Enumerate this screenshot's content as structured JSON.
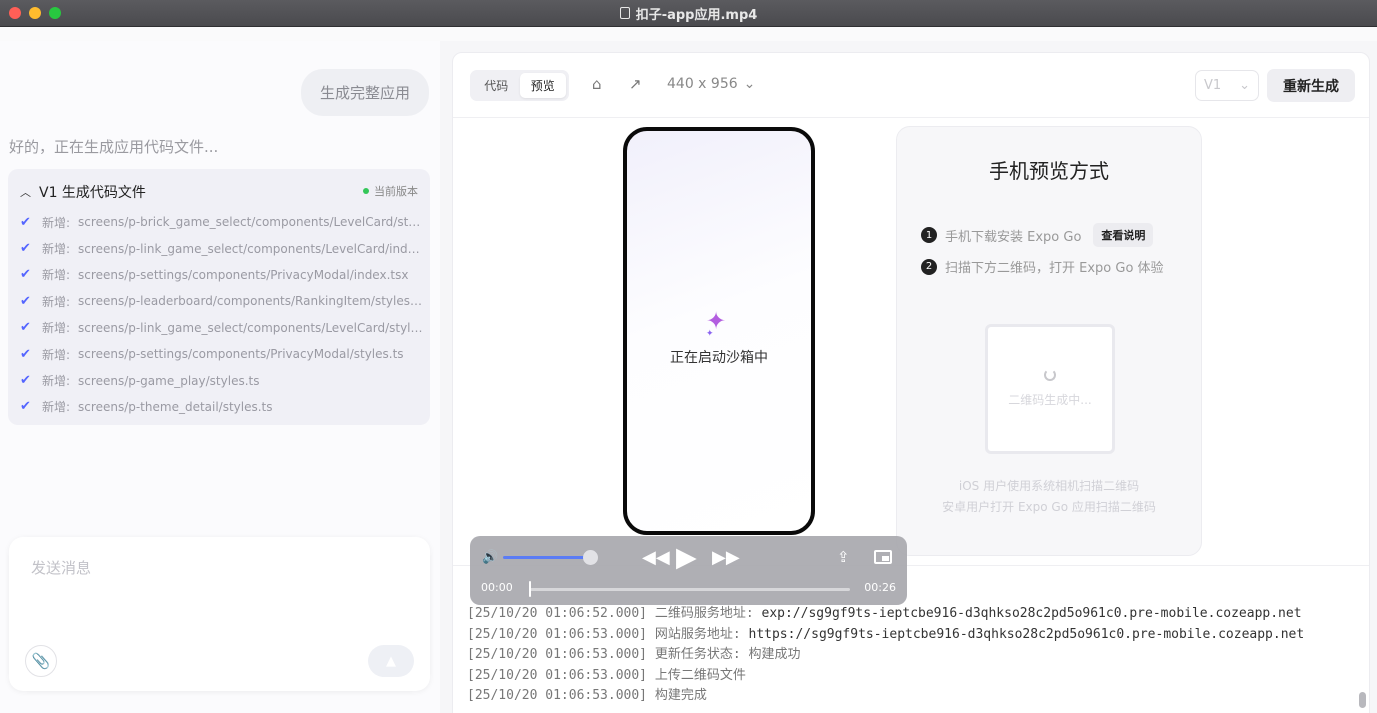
{
  "window": {
    "title": "扣子-app应用.mp4"
  },
  "chat": {
    "user_message": "生成完整应用",
    "assistant_reply": "好的，正在生成应用代码文件...",
    "files_card": {
      "title": "V1 生成代码文件",
      "version_badge": "当前版本",
      "items": [
        {
          "prefix": "新增:",
          "path": "screens/p-brick_game_select/components/LevelCard/styles..."
        },
        {
          "prefix": "新增:",
          "path": "screens/p-link_game_select/components/LevelCard/index.tsx"
        },
        {
          "prefix": "新增:",
          "path": "screens/p-settings/components/PrivacyModal/index.tsx"
        },
        {
          "prefix": "新增:",
          "path": "screens/p-leaderboard/components/RankingItem/styles.ts"
        },
        {
          "prefix": "新增:",
          "path": "screens/p-link_game_select/components/LevelCard/styles.ts"
        },
        {
          "prefix": "新增:",
          "path": "screens/p-settings/components/PrivacyModal/styles.ts"
        },
        {
          "prefix": "新增:",
          "path": "screens/p-game_play/styles.ts"
        },
        {
          "prefix": "新增:",
          "path": "screens/p-theme_detail/styles.ts"
        }
      ]
    },
    "composer_placeholder": "发送消息"
  },
  "preview": {
    "tab_code": "代码",
    "tab_preview": "预览",
    "device_size": "440 x 956",
    "version": "V1",
    "regenerate": "重新生成",
    "phone_status": "正在启动沙箱中",
    "card": {
      "title": "手机预览方式",
      "step1_num": "1",
      "step1": "手机下载安装 Expo Go",
      "step1_button": "查看说明",
      "step2_num": "2",
      "step2": "扫描下方二维码，打开 Expo Go 体验",
      "qr_status": "二维码生成中...",
      "note_ios": "iOS 用户使用系统相机扫描二维码",
      "note_android": "安卓用户打开 Expo Go 应用扫描二维码"
    }
  },
  "logs": [
    {
      "ts": "[25/10/20 01:06:52.000]",
      "msg": "二维码服务地址:",
      "val": "exp://sg9gf9ts-ieptcbe916-d3qhkso28c2pd5o961c0.pre-mobile.cozeapp.net"
    },
    {
      "ts": "[25/10/20 01:06:53.000]",
      "msg": "网站服务地址:",
      "val": "https://sg9gf9ts-ieptcbe916-d3qhkso28c2pd5o961c0.pre-mobile.cozeapp.net"
    },
    {
      "ts": "[25/10/20 01:06:53.000]",
      "msg": "更新任务状态: 构建成功",
      "val": ""
    },
    {
      "ts": "[25/10/20 01:06:53.000]",
      "msg": "上传二维码文件",
      "val": ""
    },
    {
      "ts": "[25/10/20 01:06:53.000]",
      "msg": "构建完成",
      "val": ""
    }
  ],
  "video": {
    "current_time": "00:00",
    "duration": "00:26",
    "progress": 0.0,
    "volume": 0.8
  }
}
